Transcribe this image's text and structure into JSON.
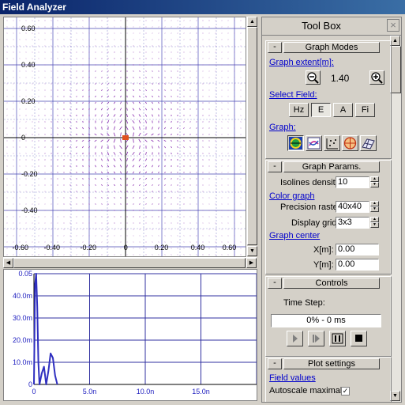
{
  "window": {
    "title": "Field Analyzer"
  },
  "field_plot": {
    "x_ticks": [
      "-0.60",
      "-0.40",
      "-0.20",
      "0",
      "0.20",
      "0.40",
      "0.60"
    ],
    "y_ticks": [
      "0.60",
      "0.40",
      "0.20",
      "0",
      "-0.20",
      "-0.40",
      "-0.60"
    ],
    "colors": {
      "grid": "#4646b4",
      "vector": "#8a2fb0",
      "source": "#e05020"
    }
  },
  "time_plot": {
    "y_ticks": [
      "0.05",
      "40.0m",
      "30.0m",
      "20.0m",
      "10.0m",
      "0"
    ],
    "x_ticks": [
      "0",
      "5.0n",
      "10.0n",
      "15.0n"
    ],
    "colors": {
      "line": "#3030c0",
      "grid": "#3030a0",
      "label": "#2020c0"
    }
  },
  "chart_data": {
    "type": "line",
    "x": [
      0,
      0.1,
      0.2,
      0.3,
      0.4,
      0.5,
      0.7,
      0.9,
      1.1,
      1.3,
      1.5,
      1.7,
      1.9,
      2.1
    ],
    "y": [
      0,
      0.045,
      0.05,
      0.035,
      0.01,
      0.0,
      0.005,
      0.008,
      0.0,
      0.006,
      0.014,
      0.012,
      0.004,
      0.0
    ],
    "xlim": [
      0,
      20
    ],
    "ylim": [
      0,
      0.05
    ]
  },
  "toolbox": {
    "title": "Tool Box",
    "close": "×",
    "graph_modes": {
      "title": "Graph Modes",
      "minimize": "-",
      "extent_label": "Graph extent[m]:",
      "extent_value": "1.40",
      "select_field_label": "Select Field:",
      "field_buttons": [
        "Hz",
        "E",
        "A",
        "Fi"
      ],
      "graph_label": "Graph:",
      "graph_icons": [
        "isolines-icon",
        "color-map-icon",
        "vectors-icon",
        "polar-icon",
        "surface-icon"
      ]
    },
    "graph_params": {
      "title": "Graph Params.",
      "minimize": "-",
      "isolines_label": "Isolines density:",
      "isolines_value": "10",
      "color_graph_label": "Color graph",
      "raster_label": "Precision raster:",
      "raster_value": "40x40",
      "grid_label": "Display grid:",
      "grid_value": "3x3",
      "center_label": "Graph center",
      "x_label": "X[m]:",
      "x_value": "0.00",
      "y_label": "Y[m]:",
      "y_value": "0.00"
    },
    "controls": {
      "title": "Controls",
      "minimize": "-",
      "time_step_label": "Time Step:",
      "progress_text": "0% - 0 ms"
    },
    "plot_settings": {
      "title": "Plot settings",
      "minimize": "-",
      "field_values_label": "Field values",
      "autoscale_label": "Autoscale maximal",
      "autoscale_checked": "✓"
    }
  }
}
